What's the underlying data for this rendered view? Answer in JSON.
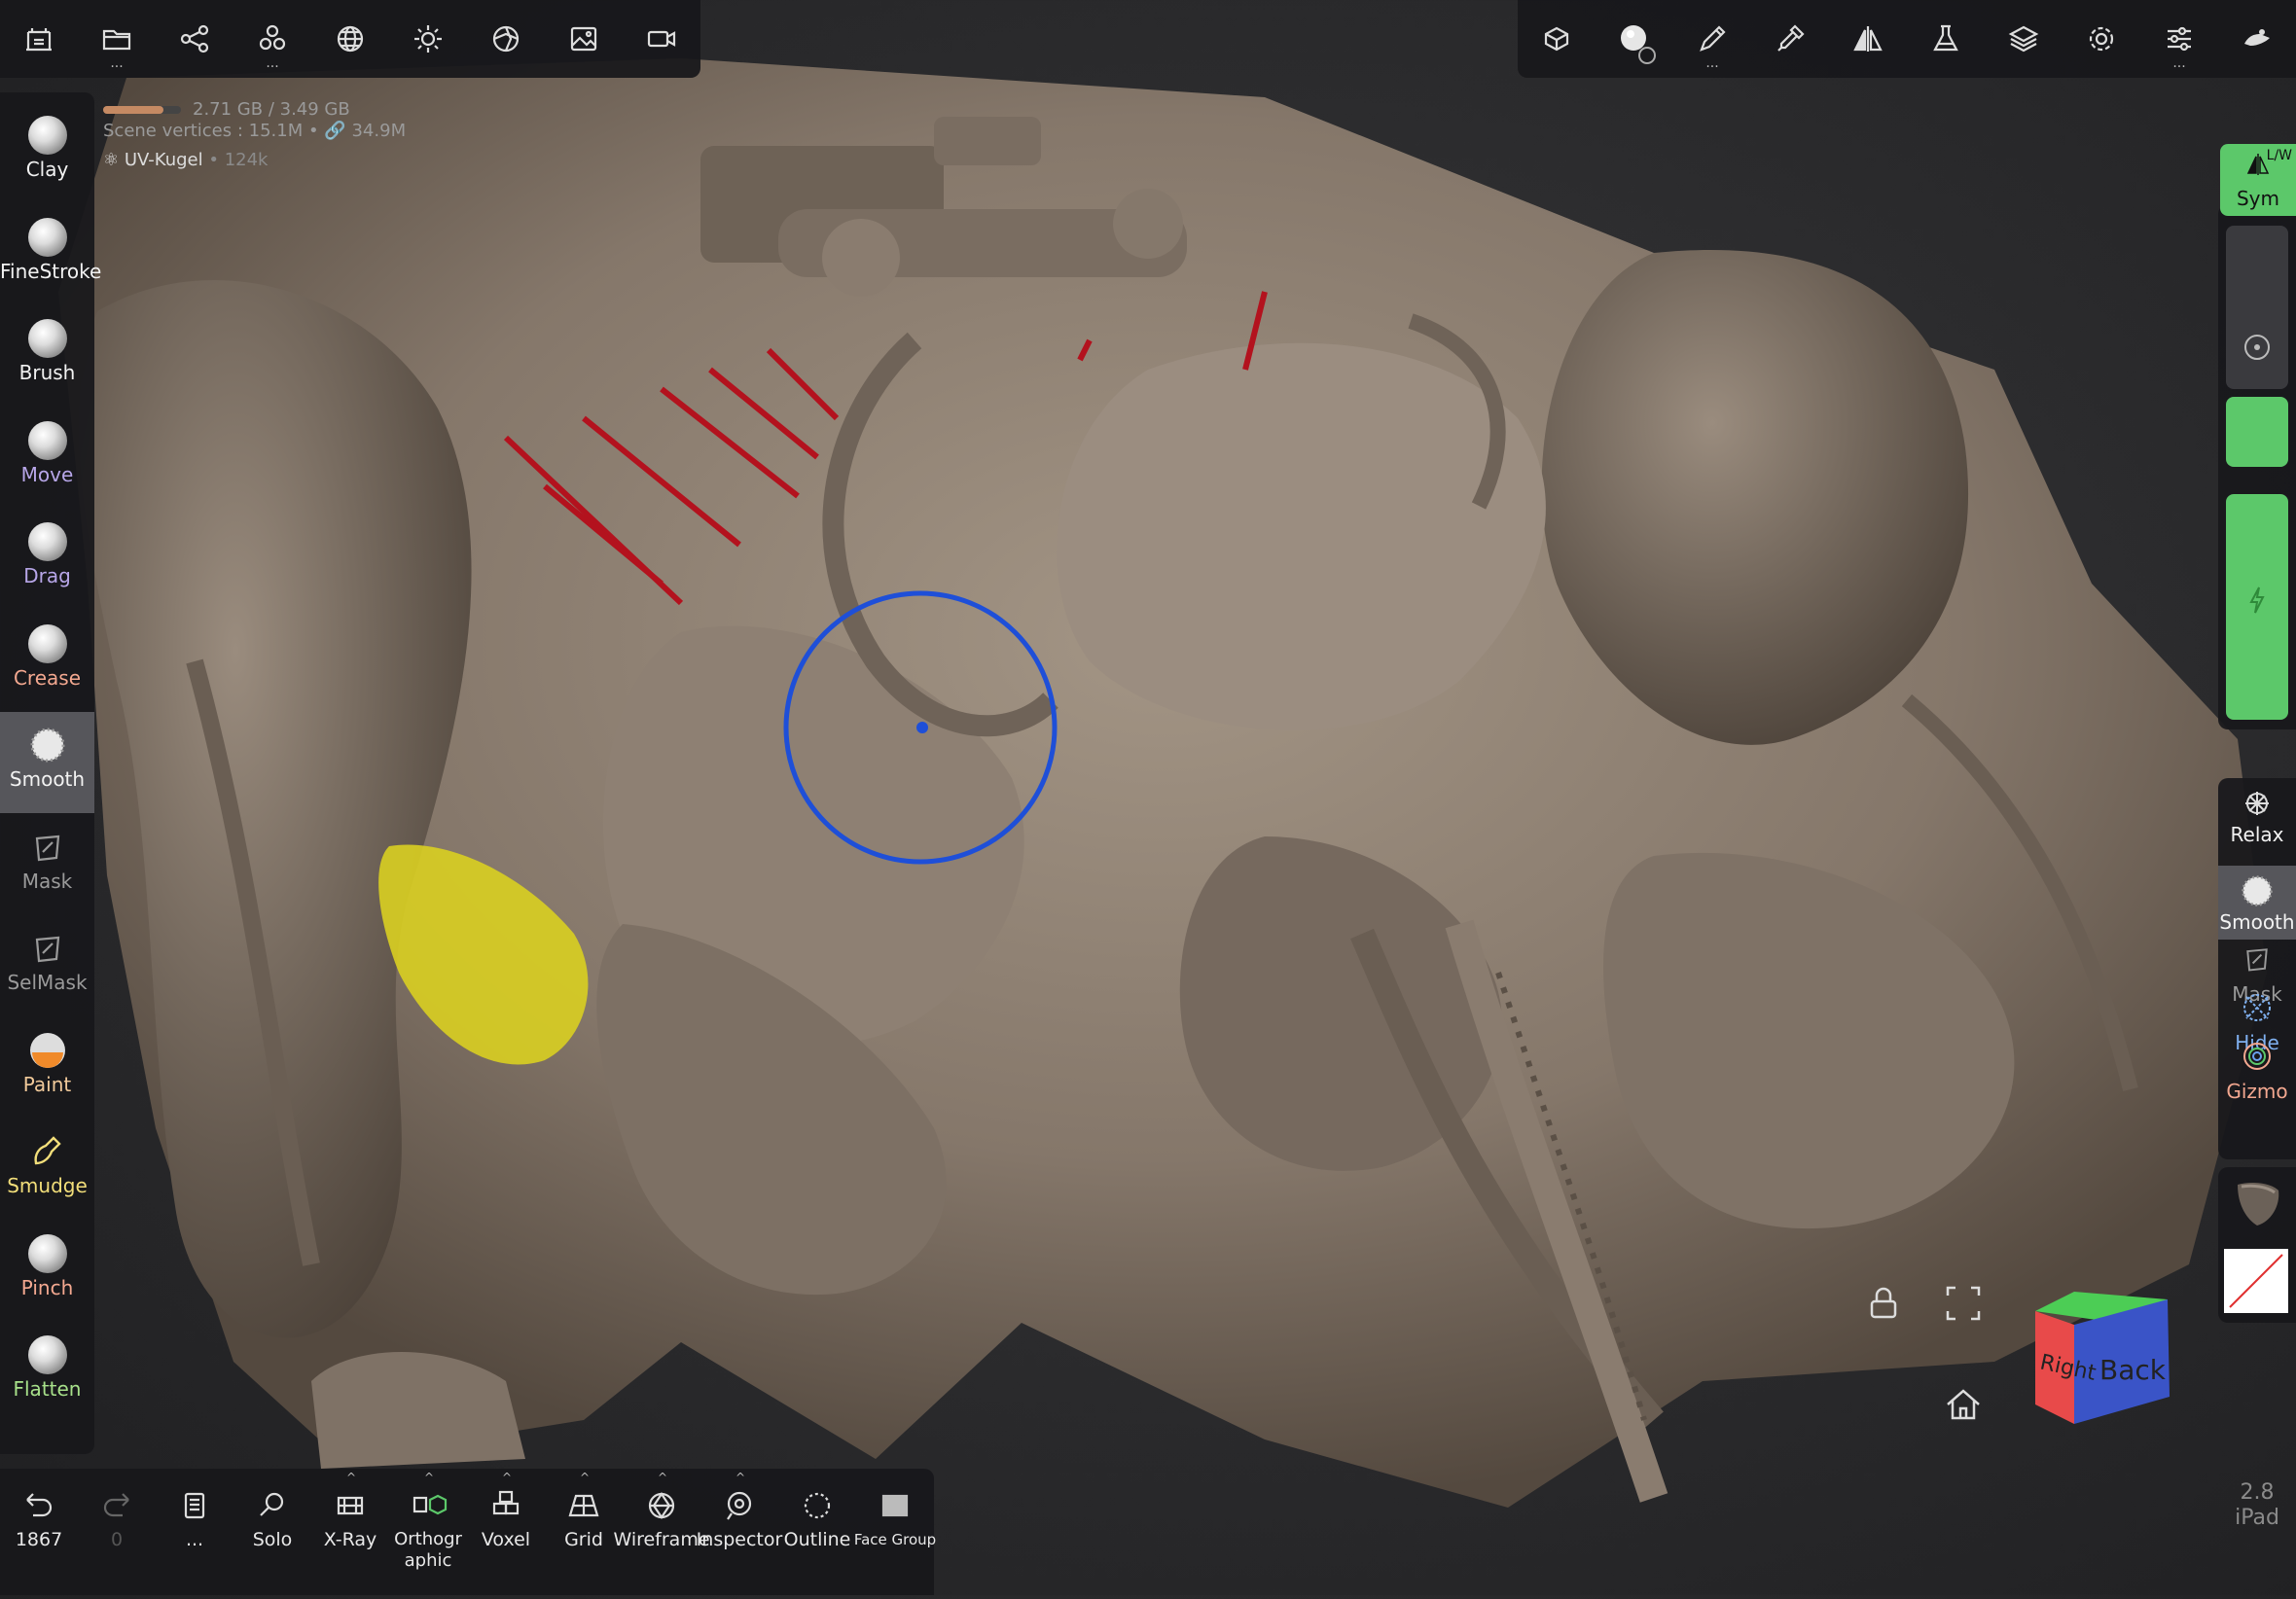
{
  "memory": {
    "used": "2.71 GB",
    "total": "3.49 GB",
    "fill": 0.78
  },
  "scene": {
    "vertices_label": "Scene vertices :",
    "vertices": "15.1M",
    "links": "34.9M"
  },
  "object": {
    "name": "UV-Kugel",
    "count": "124k"
  },
  "top_left_icons": [
    "scene-icon",
    "folder-icon",
    "share-icon",
    "layers-nodes-icon",
    "sphere-icon",
    "sun-icon",
    "material-icon",
    "image-icon",
    "camera-icon"
  ],
  "top_right_icons": [
    "cube-icon",
    "brush-material-icon",
    "pen-icon",
    "dropper-icon",
    "symmetry-icon",
    "flask-icon",
    "layers-icon",
    "settings-icon",
    "sliders-icon",
    "bucket-icon"
  ],
  "left_tools": [
    {
      "label": "Clay",
      "color": "#f2f2f2"
    },
    {
      "label": "FineStroke",
      "color": "#f2f2f2"
    },
    {
      "label": "Brush",
      "color": "#f2f2f2"
    },
    {
      "label": "Move",
      "color": "#b7a6e8"
    },
    {
      "label": "Drag",
      "color": "#b7a6e8"
    },
    {
      "label": "Crease",
      "color": "#f3a890"
    },
    {
      "label": "Smooth",
      "color": "#f2f2f2"
    },
    {
      "label": "Mask",
      "color": "#9a9a9a"
    },
    {
      "label": "SelMask",
      "color": "#9a9a9a"
    },
    {
      "label": "Paint",
      "color": "#f0c99a"
    },
    {
      "label": "Smudge",
      "color": "#f2de7a"
    },
    {
      "label": "Pinch",
      "color": "#f3a890"
    },
    {
      "label": "Flatten",
      "color": "#a7e08a"
    }
  ],
  "right": {
    "sym_label": "Sym",
    "sym_sub": "L/W",
    "tools": [
      {
        "label": "Relax",
        "color": "#f2f2f2"
      },
      {
        "label": "Smooth",
        "color": "#f2f2f2"
      },
      {
        "label": "Mask",
        "color": "#9a9a9a"
      },
      {
        "label": "Hide",
        "color": "#7fb0f0"
      },
      {
        "label": "Gizmo",
        "color": "#f3a890"
      }
    ],
    "version": "2.8",
    "device": "iPad"
  },
  "bottom": [
    {
      "label": "1867",
      "icon": "undo-icon"
    },
    {
      "label": "0",
      "icon": "redo-icon"
    },
    {
      "label": "...",
      "icon": "notes-icon"
    },
    {
      "label": "Solo",
      "icon": "search-icon"
    },
    {
      "label": "X-Ray",
      "icon": "xray-icon"
    },
    {
      "label": "Orthographic",
      "icon": "ortho-icon"
    },
    {
      "label": "Voxel",
      "icon": "voxel-icon"
    },
    {
      "label": "Grid",
      "icon": "grid-icon"
    },
    {
      "label": "Wireframe",
      "icon": "wireframe-icon"
    },
    {
      "label": "Inspector",
      "icon": "inspector-icon"
    },
    {
      "label": "Outline",
      "icon": "outline-icon"
    },
    {
      "label": "Face Group",
      "icon": "facegroup-icon"
    }
  ],
  "nav_cube": {
    "right_label": "Right",
    "back_label": "Back"
  },
  "colors": {
    "accent_green": "#5cc86a",
    "brush_ring": "#1e4fd8",
    "model": "#8b7d70",
    "mask_yellow": "#d9cf21",
    "spikes": "#b3121e"
  }
}
